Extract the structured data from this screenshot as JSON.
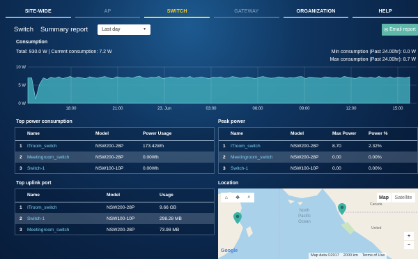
{
  "nav": [
    "SITE-WIDE",
    "AP",
    "SWITCH",
    "GATEWAY",
    "ORGANIZATION",
    "HELP"
  ],
  "nav_state": [
    "normal",
    "inactive",
    "active",
    "inactive",
    "normal",
    "normal"
  ],
  "header": {
    "title": "Switch",
    "subtitle": "Summary report",
    "range": "Last day",
    "email_label": "Email report"
  },
  "consumption": {
    "title": "Consumption",
    "total": "Total: 930.0 W | Current consumption: 7.2 W",
    "min": "Min consumption (Past 24.00hr): 0.0 W",
    "max": "Max consumption (Past 24.00hr): 8.7 W"
  },
  "chart_data": {
    "type": "area",
    "yticks": [
      "10 W",
      "5 W",
      "0 W"
    ],
    "ylim": [
      0,
      10
    ],
    "xticks": [
      "18:00",
      "21:00",
      "23. Jun",
      "03:00",
      "06:00",
      "09:00",
      "12:00",
      "15:00"
    ],
    "values": [
      7.0,
      7.0,
      1.2,
      5.2,
      7.0,
      6.6,
      7.2,
      6.9,
      7.3,
      6.8,
      7.1,
      7.4,
      6.9,
      7.2,
      7.0,
      6.8,
      7.3,
      7.1,
      6.9,
      7.2,
      7.4,
      7.0,
      6.8,
      7.3,
      7.1,
      7.0,
      7.2,
      6.9,
      7.3,
      7.5,
      7.0,
      6.9,
      7.2,
      7.1,
      7.4,
      6.8,
      7.0,
      7.3,
      7.1,
      6.9,
      7.2,
      7.0,
      7.4,
      6.9,
      7.1,
      7.3,
      7.0,
      6.8,
      7.2,
      7.1,
      7.3,
      6.9,
      7.0,
      7.4,
      7.2,
      6.9,
      7.1,
      7.3,
      7.0,
      6.8,
      7.2,
      7.4,
      7.1,
      6.9,
      7.0,
      7.3,
      7.2,
      6.9,
      7.1,
      7.0,
      7.3,
      7.4,
      6.8,
      7.2,
      7.1,
      7.0,
      6.9,
      7.3,
      7.2,
      7.0,
      7.1,
      6.9,
      7.4,
      7.2,
      7.0,
      6.8,
      7.3,
      7.1,
      7.0,
      7.2,
      6.9,
      7.4,
      7.1,
      7.0,
      7.3,
      6.9,
      7.2,
      7.1,
      7.0,
      7.3
    ],
    "color": "#3fa9b8"
  },
  "top_power": {
    "title": "Top power consumption",
    "columns": [
      "Name",
      "Model",
      "Power Usage"
    ],
    "rows": [
      {
        "n": "1",
        "name": "ITroom_switch",
        "model": "NSW200-28P",
        "value": "173.42Wh"
      },
      {
        "n": "2",
        "name": "Meetingroom_switch",
        "model": "NSW200-28P",
        "value": "0.00Wh"
      },
      {
        "n": "3",
        "name": "Switch-1",
        "model": "NSW100-10P",
        "value": "0.00Wh"
      }
    ]
  },
  "peak_power": {
    "title": "Peak power",
    "columns": [
      "Name",
      "Model",
      "Max Power",
      "Power %"
    ],
    "rows": [
      {
        "n": "1",
        "name": "ITroom_switch",
        "model": "NSW200-28P",
        "max": "8.70",
        "pct": "2.32%"
      },
      {
        "n": "2",
        "name": "Meetingroom_switch",
        "model": "NSW200-28P",
        "max": "0.00",
        "pct": "0.00%"
      },
      {
        "n": "3",
        "name": "Switch-1",
        "model": "NSW100-10P",
        "max": "0.00",
        "pct": "0.00%"
      }
    ]
  },
  "uplink": {
    "title": "Top uplink port",
    "columns": [
      "Name",
      "Model",
      "Usage"
    ],
    "rows": [
      {
        "n": "1",
        "name": "ITroom_switch",
        "model": "NSW200-28P",
        "value": "9.66 GB"
      },
      {
        "n": "2",
        "name": "Switch-1",
        "model": "NSW100-10P",
        "value": "298.28 MB"
      },
      {
        "n": "3",
        "name": "Meetingroom_switch",
        "model": "NSW200-28P",
        "value": "73.98 MB"
      }
    ]
  },
  "location": {
    "title": "Location",
    "map_btn": "Map",
    "sat_btn": "Satellite",
    "ocean": [
      "North",
      "Pacific",
      "Ocean"
    ],
    "labels": {
      "canada": "Canada",
      "usa": "United",
      "google": "Google"
    },
    "attribution": "Map data ©2017",
    "scale": "2000 km",
    "terms": "Terms of Use",
    "zoom_in": "+",
    "zoom_out": "−"
  }
}
